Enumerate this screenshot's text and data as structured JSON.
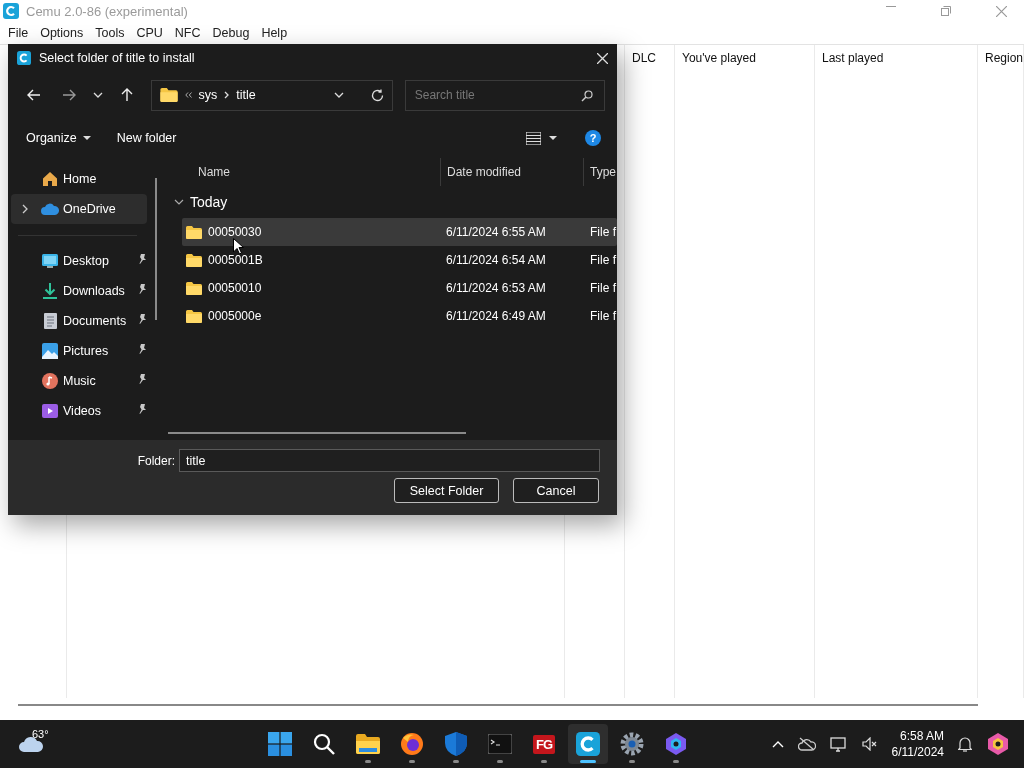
{
  "app": {
    "title": "Cemu 2.0-86 (experimental)",
    "menu": [
      "File",
      "Options",
      "Tools",
      "CPU",
      "NFC",
      "Debug",
      "Help"
    ],
    "columns": [
      "DLC",
      "You've played",
      "Last played",
      "Region"
    ]
  },
  "dialog": {
    "title": "Select folder of title to install",
    "breadcrumb": [
      "sys",
      "title"
    ],
    "search": {
      "placeholder": "Search title"
    },
    "organize": "Organize",
    "new_folder": "New folder",
    "help": "?",
    "sidebar": [
      {
        "label": "Home",
        "selected": false,
        "pinned": false,
        "expandable": false
      },
      {
        "label": "OneDrive",
        "selected": true,
        "pinned": false,
        "expandable": true
      },
      {
        "label": "Desktop",
        "selected": false,
        "pinned": true,
        "expandable": false
      },
      {
        "label": "Downloads",
        "selected": false,
        "pinned": true,
        "expandable": false
      },
      {
        "label": "Documents",
        "selected": false,
        "pinned": true,
        "expandable": false
      },
      {
        "label": "Pictures",
        "selected": false,
        "pinned": true,
        "expandable": false
      },
      {
        "label": "Music",
        "selected": false,
        "pinned": true,
        "expandable": false
      },
      {
        "label": "Videos",
        "selected": false,
        "pinned": true,
        "expandable": false
      }
    ],
    "columns": [
      "Name",
      "Date modified",
      "Type"
    ],
    "group": {
      "label": "Today",
      "expanded": true
    },
    "rows": [
      {
        "name": "00050030",
        "date": "6/11/2024 6:55 AM",
        "type": "File f",
        "selected": true
      },
      {
        "name": "0005001B",
        "date": "6/11/2024 6:54 AM",
        "type": "File f",
        "selected": false
      },
      {
        "name": "00050010",
        "date": "6/11/2024 6:53 AM",
        "type": "File f",
        "selected": false
      },
      {
        "name": "0005000e",
        "date": "6/11/2024 6:49 AM",
        "type": "File f",
        "selected": false
      }
    ],
    "folder_label": "Folder:",
    "folder_value": "title",
    "buttons": [
      "Select Folder",
      "Cancel"
    ]
  },
  "taskbar": {
    "weather": "63°",
    "apps": [
      {
        "kind": "start",
        "active": false,
        "running": false
      },
      {
        "kind": "search",
        "active": false,
        "running": false
      },
      {
        "kind": "explorer",
        "active": false,
        "running": true
      },
      {
        "kind": "browser",
        "active": false,
        "running": true
      },
      {
        "kind": "shield",
        "active": false,
        "running": true
      },
      {
        "kind": "terminal",
        "active": false,
        "running": true
      },
      {
        "kind": "fg",
        "label": "FG",
        "active": false,
        "running": true
      },
      {
        "kind": "cemu",
        "active": true,
        "running": true
      },
      {
        "kind": "settings",
        "active": false,
        "running": true
      },
      {
        "kind": "copilot",
        "active": false,
        "running": true
      }
    ],
    "time": "6:58 AM",
    "date": "6/11/2024"
  }
}
